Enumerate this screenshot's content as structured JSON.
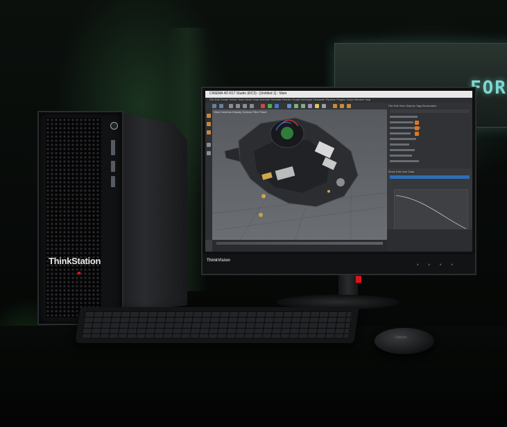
{
  "scene": {
    "tower": {
      "brand": "ThinkStation"
    },
    "background_sign": {
      "text": "FORC"
    },
    "monitor": {
      "chin_brand": "ThinkVision",
      "app": {
        "title": "CINEMA 4D R17 Studio (RC3) - [Untitled 1] - Main",
        "menu": "File  Edit  Create  Select  Tools  Mesh  Snap  Animate  Simulate  Render  Sculpt  MoGraph  Character  Pipeline  Plugins  Script  Window  Help",
        "viewport_menu": "View  Cameras  Display  Options  Filter  Panel",
        "attribute_tabs": "Mode  Edit  User Data",
        "object_panel_tabs": "File  Edit  View  Objects  Tags  Bookmarks"
      }
    },
    "mouse": {
      "brand": "Lenovo"
    }
  },
  "colors": {
    "accent_red": "#d9141e",
    "ambient_green": "#3c7a46",
    "sign_cyan": "#7fd8cf"
  }
}
